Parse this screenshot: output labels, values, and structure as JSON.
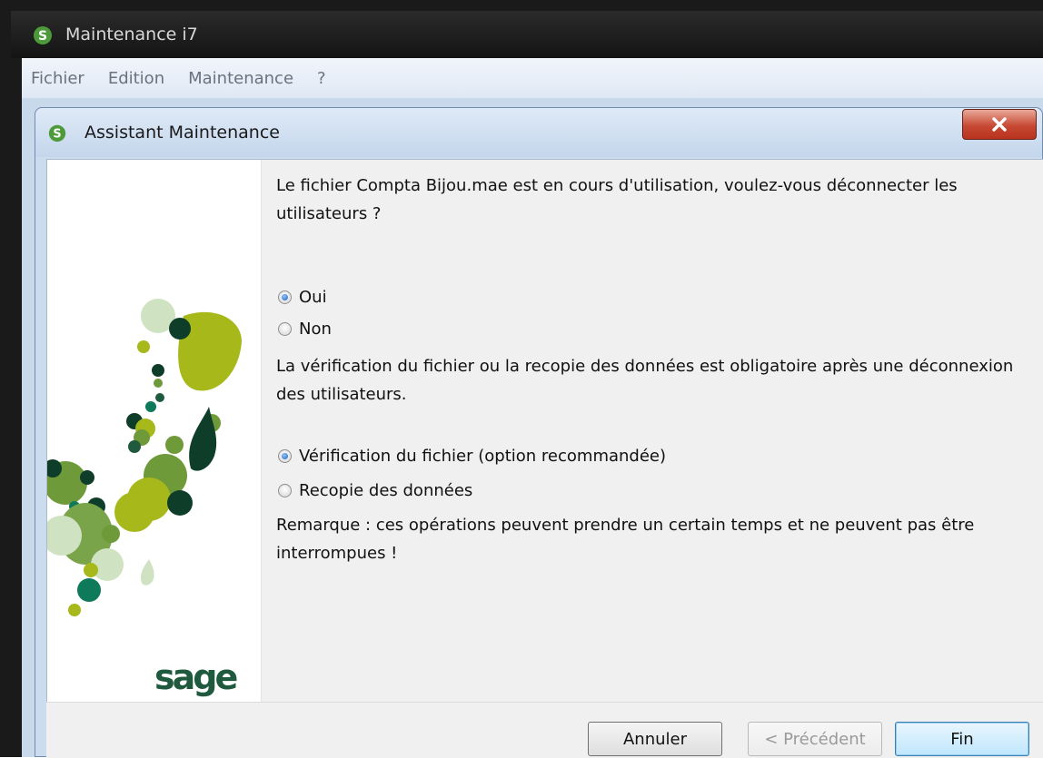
{
  "app": {
    "title": "Maintenance i7",
    "menu": [
      "Fichier",
      "Edition",
      "Maintenance",
      "?"
    ]
  },
  "dialog": {
    "title": "Assistant Maintenance",
    "question": "Le fichier Compta Bijou.mae est en cours d'utilisation, voulez-vous déconnecter les utilisateurs ?",
    "options_disconnect": [
      {
        "label": "Oui",
        "checked": true
      },
      {
        "label": "Non",
        "checked": false
      }
    ],
    "info": "La vérification du fichier ou la recopie des données est obligatoire après une déconnexion des utilisateurs.",
    "options_operation": [
      {
        "label": "Vérification du fichier (option recommandée)",
        "checked": true
      },
      {
        "label": "Recopie des données",
        "checked": false
      }
    ],
    "remark": "Remarque : ces opérations peuvent prendre un certain temps et ne peuvent pas être interrompues !",
    "logo_text": "sage"
  },
  "buttons": {
    "cancel": "Annuler",
    "previous": "< Précédent",
    "finish": "Fin"
  },
  "colors": {
    "sage_green": "#1f5a3e",
    "lime": "#a7b81a",
    "mid_green": "#6f9a3a",
    "dark_green": "#0e3d2a"
  },
  "icons": {
    "app": "sage-app-icon",
    "dialog": "sage-app-icon",
    "close": "close-icon"
  }
}
